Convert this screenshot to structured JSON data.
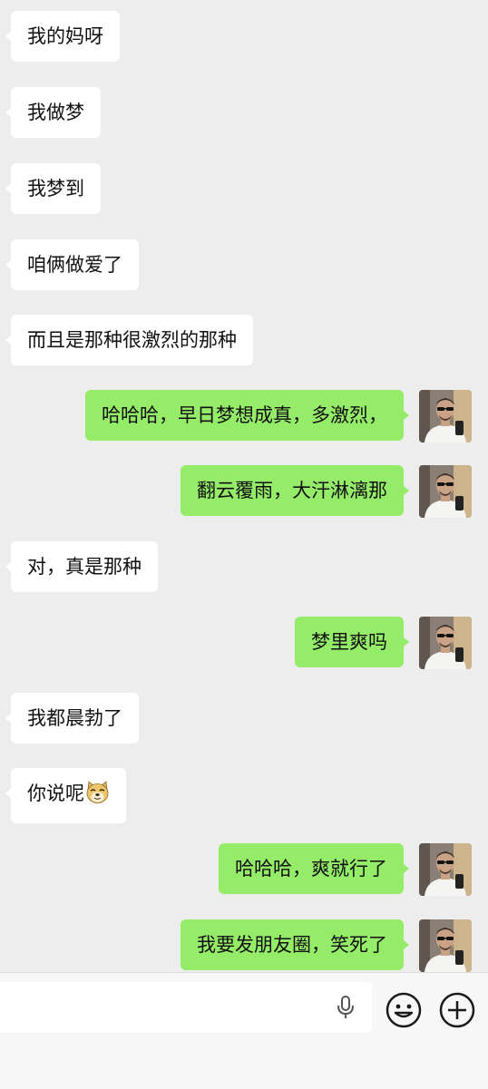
{
  "messages": [
    {
      "side": "left",
      "text": "我的妈呀"
    },
    {
      "side": "left",
      "text": "我做梦"
    },
    {
      "side": "left",
      "text": "我梦到"
    },
    {
      "side": "left",
      "text": "咱俩做爱了"
    },
    {
      "side": "left",
      "text": "而且是那种很激烈的那种"
    },
    {
      "side": "right",
      "text": "哈哈哈，早日梦想成真，多激烈，"
    },
    {
      "side": "right",
      "text": "翻云覆雨，大汗淋漓那"
    },
    {
      "side": "left",
      "text": "对，真是那种"
    },
    {
      "side": "right",
      "text": "梦里爽吗"
    },
    {
      "side": "left",
      "text": "我都晨勃了"
    },
    {
      "side": "left",
      "text": "你说呢",
      "emoji": "doge-emoji"
    },
    {
      "side": "right",
      "text": "哈哈哈，爽就行了"
    },
    {
      "side": "right",
      "text": "我要发朋友圈，笑死了"
    }
  ],
  "composer": {
    "input_value": "",
    "icons": [
      "microphone-icon",
      "emoji-icon",
      "plus-icon"
    ]
  },
  "colors": {
    "background": "#ededed",
    "incoming_bubble": "#ffffff",
    "outgoing_bubble": "#95ec69",
    "text": "#111111"
  }
}
